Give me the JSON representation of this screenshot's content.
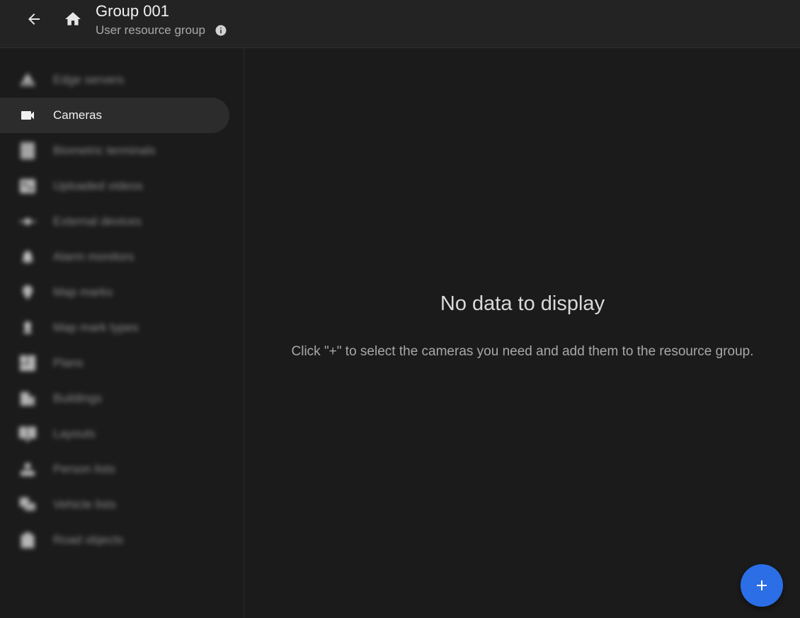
{
  "header": {
    "title": "Group 001",
    "subtitle": "User resource group",
    "back_icon": "arrow-left-icon",
    "home_icon": "home-icon",
    "info_icon": "info-icon"
  },
  "sidebar": {
    "items": [
      {
        "label": "Edge servers",
        "icon": "server-icon",
        "active": false,
        "blurred": true
      },
      {
        "label": "Cameras",
        "icon": "video-camera-icon",
        "active": true,
        "blurred": false
      },
      {
        "label": "Biometric terminals",
        "icon": "terminal-icon",
        "active": false,
        "blurred": true
      },
      {
        "label": "Uploaded videos",
        "icon": "video-library-icon",
        "active": false,
        "blurred": true
      },
      {
        "label": "External devices",
        "icon": "device-hub-icon",
        "active": false,
        "blurred": true
      },
      {
        "label": "Alarm monitors",
        "icon": "alarm-bell-icon",
        "active": false,
        "blurred": true
      },
      {
        "label": "Map marks",
        "icon": "map-pin-icon",
        "active": false,
        "blurred": true
      },
      {
        "label": "Map mark types",
        "icon": "map-pin-type-icon",
        "active": false,
        "blurred": true
      },
      {
        "label": "Plans",
        "icon": "plans-icon",
        "active": false,
        "blurred": true
      },
      {
        "label": "Buildings",
        "icon": "building-icon",
        "active": false,
        "blurred": true
      },
      {
        "label": "Layouts",
        "icon": "layout-icon",
        "active": false,
        "blurred": true
      },
      {
        "label": "Person lists",
        "icon": "person-list-icon",
        "active": false,
        "blurred": true
      },
      {
        "label": "Vehicle lists",
        "icon": "vehicle-list-icon",
        "active": false,
        "blurred": true
      },
      {
        "label": "Road objects",
        "icon": "road-object-icon",
        "active": false,
        "blurred": true
      }
    ]
  },
  "main": {
    "empty_title": "No data to display",
    "empty_description": "Click \"+\" to select the cameras you need and add them to the resource group."
  },
  "fab": {
    "icon": "plus-icon",
    "color": "#2b6ee6"
  },
  "colors": {
    "background": "#1b1b1b",
    "header": "#232323",
    "active_item": "#2c2c2c",
    "accent": "#2b6ee6"
  }
}
